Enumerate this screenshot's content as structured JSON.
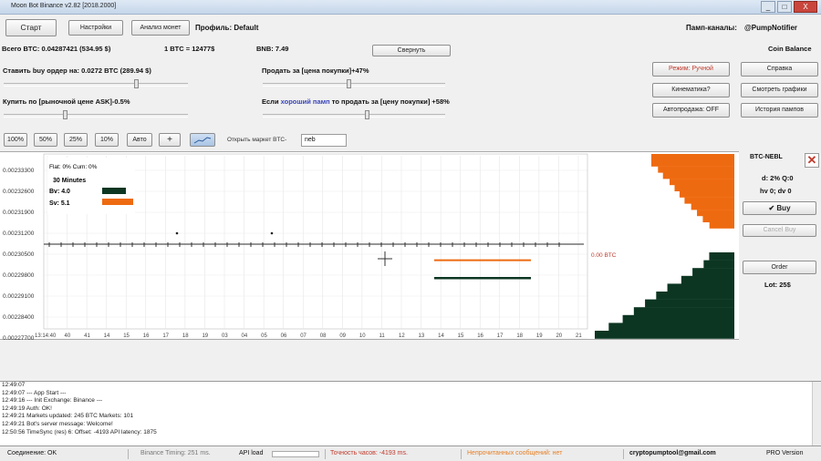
{
  "window": {
    "title": "Moon Bot Binance v2.82 [2018.2000]",
    "minimize": "_",
    "maximize": "□",
    "close": "X"
  },
  "toolbar": {
    "start": "Старт",
    "settings": "Настройки",
    "analysis": "Анализ монет",
    "profile": "Профиль: Default",
    "pump_channels": "Памп-каналы:",
    "pump_name": "@PumpNotifier"
  },
  "balance": {
    "total": "Всего BTC: 0.04287421 (534.95 $)",
    "rate": "1 BTC = 12477$",
    "bnb": "BNB: 7.49",
    "collapse": "Свернуть",
    "coin_balance": "Coin Balance"
  },
  "orders": {
    "buy_order": "Ставить buy ордер на: 0.0272 BTC  (289.94 $)",
    "buy_market": "Купить по [рыночной цене ASK]-0.5%",
    "sell_target": "Продать за [цена покупки]+47%",
    "good_pump_prefix": "Если ",
    "good_pump_word": "хороший памп",
    "good_pump_suffix": " то продать за [цену покупки] +58%"
  },
  "right_buttons": {
    "mode": "Режим: Ручной",
    "help": "Справка",
    "kinematics": "Кинематика?",
    "view_charts": "Смотреть графики",
    "autosell": "Автопродажа: OFF",
    "pump_history": "История пампов"
  },
  "quick_buttons": [
    "100%",
    "50%",
    "25%",
    "10%",
    "Авто",
    "+"
  ],
  "open_market": {
    "label": "Открыть маркет BTC-",
    "value": "neb"
  },
  "chart_data": {
    "type": "line",
    "y_ticks": [
      "0.00233300",
      "0.00232600",
      "0.00231900",
      "0.00231200",
      "0.00230500",
      "0.00229800",
      "0.00229100",
      "0.00228400",
      "0.00227700"
    ],
    "x_ticks": [
      "13:14:40",
      "40",
      "41",
      "14",
      "15",
      "16",
      "17",
      "18",
      "19",
      "03",
      "04",
      "05",
      "06",
      "07",
      "08",
      "09",
      "10",
      "11",
      "12",
      "13",
      "14",
      "15",
      "16",
      "17",
      "18",
      "19",
      "20",
      "21"
    ],
    "legend": {
      "flat": "Flat: 0%  Cum: 0%",
      "interval": "30 Minutes",
      "bv": "Bv: 4.0",
      "sv": "Sv: 5.1"
    },
    "colors": {
      "sell": "#ee6a10",
      "buy": "#0c3622"
    },
    "price_label": "0.00 BTC",
    "sell_line_price": 0.002303,
    "buy_line_price": 0.002297,
    "sell_book_levels": [
      100,
      100,
      92,
      86,
      78,
      72,
      66,
      60,
      52,
      45,
      38,
      30
    ],
    "buy_book_levels": [
      18,
      22,
      30,
      38,
      48,
      56,
      64,
      72,
      80,
      90,
      100
    ]
  },
  "order_panel": {
    "pair": "BTC-NEBL",
    "d_line": "d: 2% Q:0",
    "hv_line": "hv 0; dv 0",
    "buy": "Buy",
    "cancel_buy": "Cancel Buy",
    "order": "Order",
    "lot": "Lot: 25$"
  },
  "log_lines": [
    "12:49:07",
    "12:49:07     --- App Start ---",
    "12:49:16     --- Init Exchange: Binance ---",
    "12:49:19  Auth: OK!",
    "12:49:21  Markets updated: 245 BTC Markets: 101",
    "12:49:21  Bot's server message: Welcome!",
    "12:50:56  TimeSync (res) 6: Offset: -4193 API latency: 1875"
  ],
  "status": {
    "connection": "Соединение: OK",
    "timing": "Binance Timing: 251 ms.",
    "api": "API load",
    "clock_diff": "Точность часов: -4193 ms.",
    "unread": "Непрочитанных сообщений: нет",
    "email": "cryptopumptool@gmail.com",
    "version": "PRO Version"
  }
}
